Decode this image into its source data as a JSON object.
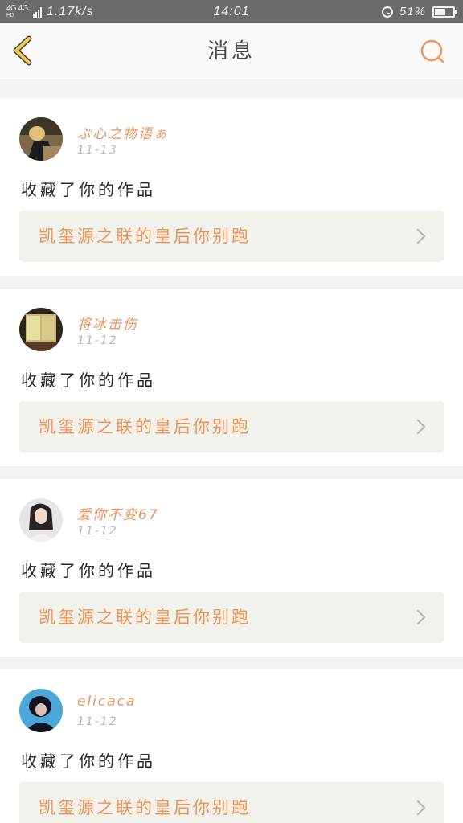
{
  "status_bar": {
    "network": "4G 4G",
    "network_sub": "HD",
    "speed": "1.17k/s",
    "time": "14:01",
    "battery_percent": "51%",
    "battery_level": 0.51,
    "icons": [
      "signal-icon",
      "alarm-icon",
      "battery-icon"
    ]
  },
  "header": {
    "title": "消息",
    "back_icon": "chevron-left-icon",
    "search_icon": "search-icon",
    "accent_color": "#f0935a",
    "back_color": "#f2c94c"
  },
  "messages": [
    {
      "username": "ぷ心之物语ぁ",
      "date": "11-13",
      "action": "收藏了你的作品",
      "work_title": "凯玺源之联的皇后你别跑"
    },
    {
      "username": "将冰击伤",
      "date": "11-12",
      "action": "收藏了你的作品",
      "work_title": "凯玺源之联的皇后你别跑"
    },
    {
      "username": "爱你不变67",
      "date": "11-12",
      "action": "收藏了你的作品",
      "work_title": "凯玺源之联的皇后你别跑"
    },
    {
      "username": "elicaca",
      "date": "11-12",
      "action": "收藏了你的作品",
      "work_title": "凯玺源之联的皇后你别跑"
    }
  ]
}
